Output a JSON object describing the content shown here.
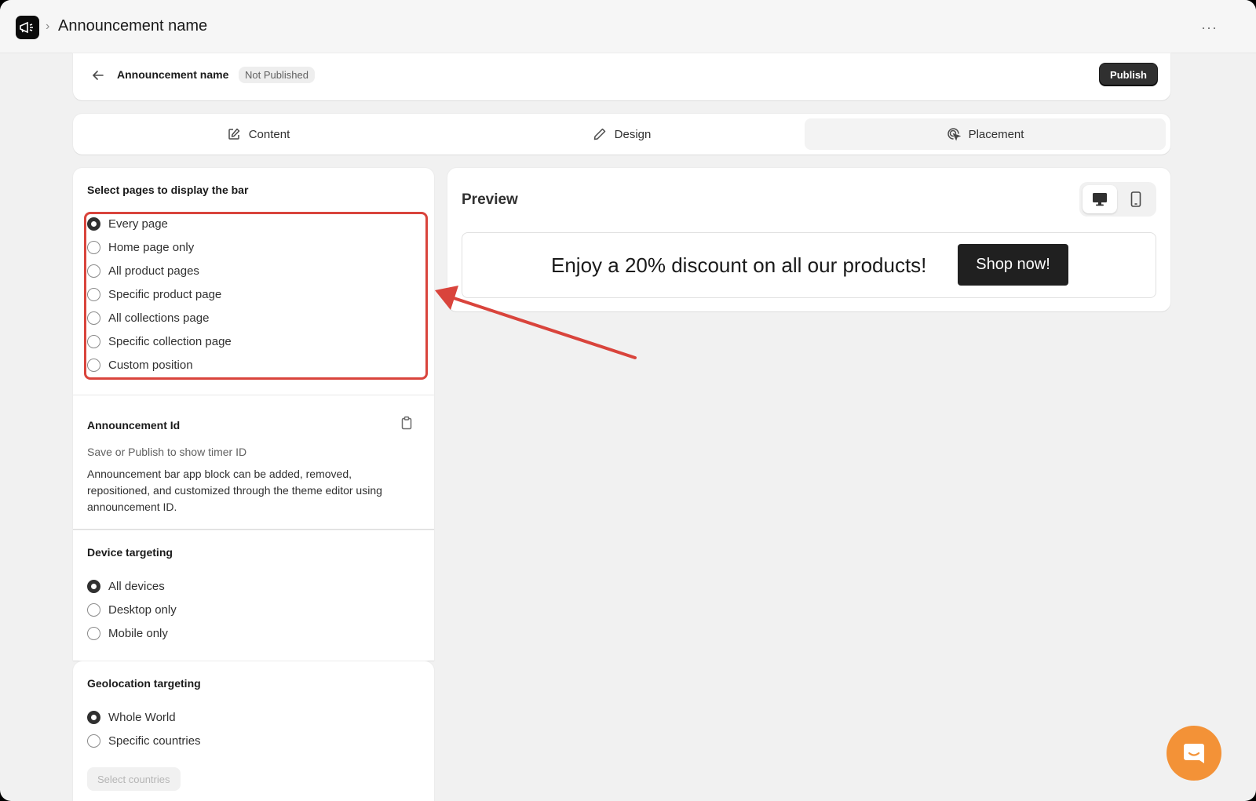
{
  "topbar": {
    "title": "Announcement name",
    "more_label": "···"
  },
  "header": {
    "name": "Announcement name",
    "status": "Not Published",
    "publish_label": "Publish"
  },
  "tabs": [
    {
      "label": "Content",
      "icon": "edit-square-icon"
    },
    {
      "label": "Design",
      "icon": "pencil-icon"
    },
    {
      "label": "Placement",
      "icon": "cursor-target-icon",
      "active": true
    }
  ],
  "pages": {
    "title": "Select pages to display the bar",
    "options": [
      {
        "label": "Every page",
        "checked": true
      },
      {
        "label": "Home page only"
      },
      {
        "label": "All product pages"
      },
      {
        "label": "Specific product page"
      },
      {
        "label": "All collections page"
      },
      {
        "label": "Specific collection page"
      },
      {
        "label": "Custom position"
      }
    ],
    "id_title": "Announcement Id",
    "id_hint": "Save or Publish to show timer ID",
    "id_description": "Announcement bar app block can be added, removed, repositioned, and customized through the theme editor using announcement ID."
  },
  "device": {
    "title": "Device targeting",
    "options": [
      {
        "label": "All devices",
        "checked": true
      },
      {
        "label": "Desktop only"
      },
      {
        "label": "Mobile only"
      }
    ]
  },
  "geo": {
    "title": "Geolocation targeting",
    "options": [
      {
        "label": "Whole World",
        "checked": true
      },
      {
        "label": "Specific countries"
      }
    ],
    "select_label": "Select countries"
  },
  "preview": {
    "title": "Preview",
    "bar_text": "Enjoy a 20% discount on all our products!",
    "button_label": "Shop now!",
    "active_device": "desktop"
  },
  "colors": {
    "annotation": "#d9443c",
    "chat_button": "#f39237",
    "primary_button": "#303030"
  }
}
